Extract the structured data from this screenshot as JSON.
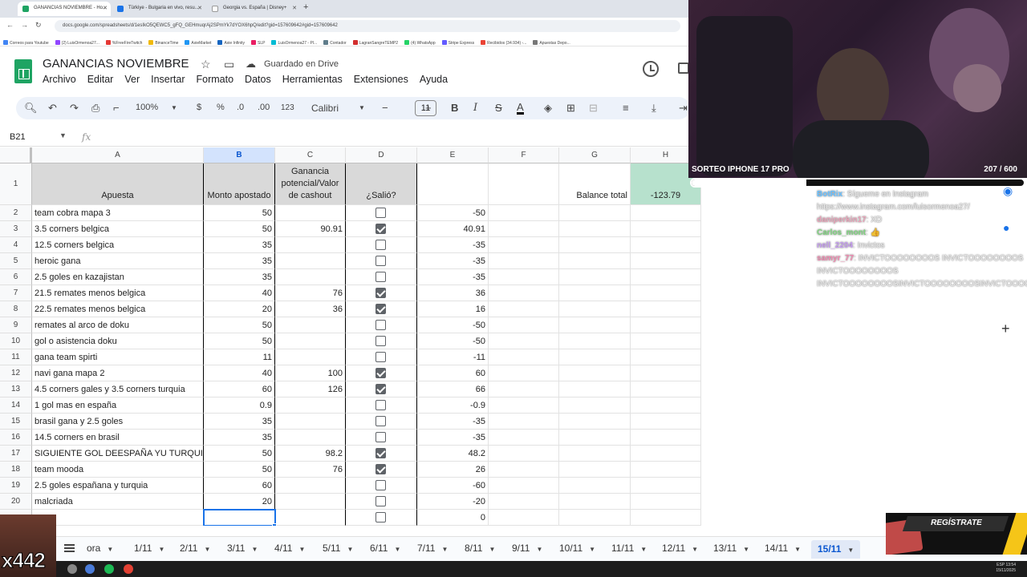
{
  "browser": {
    "tabs": [
      {
        "label": "GANANCIAS NOVIEMBRE - Ho...",
        "color": "#1fa463",
        "active": true
      },
      {
        "label": "Türkiye - Bulgaria en vivo, resu...",
        "color": "#1a73e8",
        "active": false
      },
      {
        "label": "Georgia vs. España | Disney+",
        "color": "#ffffff",
        "active": false
      }
    ],
    "url": "docs.google.com/spreadsheets/d/1esIkO5QEWC5_gFQ_GEHmuqrAj2SPmYk7dYOX6hpQ/edit?gid=157609642#gid=157609642",
    "bookmarks": [
      {
        "label": "Correos para Youtube",
        "color": "#4285f4"
      },
      {
        "label": "(2) LuisOrmenoa27...",
        "color": "#9146ff"
      },
      {
        "label": "%FreeFireTwitch",
        "color": "#e53935"
      },
      {
        "label": "BinanceTime",
        "color": "#f0b90b"
      },
      {
        "label": "AxieMarket",
        "color": "#2196f3"
      },
      {
        "label": "Axie Infinity",
        "color": "#1565c0"
      },
      {
        "label": "SLP",
        "color": "#e91e63"
      },
      {
        "label": "LuisOrmenoa27 - Pl...",
        "color": "#00bcd4"
      },
      {
        "label": "Contador",
        "color": "#607d8b"
      },
      {
        "label": "LagranSangreTEMP2",
        "color": "#d32f2f"
      },
      {
        "label": "(4) WhatsApp",
        "color": "#25d366"
      },
      {
        "label": "Stripe Express",
        "color": "#635bff"
      },
      {
        "label": "Recibidos (34.934) -...",
        "color": "#ea4335"
      },
      {
        "label": "Apuestas Depo...",
        "color": "#777777"
      }
    ]
  },
  "doc": {
    "title": "GANANCIAS NOVIEMBRE",
    "saved_status": "Guardado en Drive",
    "menu": [
      "Archivo",
      "Editar",
      "Ver",
      "Insertar",
      "Formato",
      "Datos",
      "Herramientas",
      "Extensiones",
      "Ayuda"
    ]
  },
  "toolbar": {
    "zoom": "100%",
    "currency": "$",
    "percent": "%",
    "dec_less": ".0",
    "dec_more": ".00",
    "number_format": "123",
    "font": "Calibri",
    "font_size": "11",
    "bold": "B",
    "italic": "I",
    "strike": "S",
    "text_color": "A"
  },
  "formula_bar": {
    "name_box": "B21",
    "fx": "fx"
  },
  "grid": {
    "columns": [
      "A",
      "B",
      "C",
      "D",
      "E",
      "F",
      "G",
      "H"
    ],
    "header": {
      "apuesta": "Apuesta",
      "monto": "Monto apostado",
      "ganancia_l1": "Ganancia",
      "ganancia_l2": "potencial/Valor",
      "ganancia_l3": "de cashout",
      "salio": "¿Salió?",
      "balance_label": "Balance total",
      "balance_value": "-123.79"
    },
    "rows": [
      {
        "n": "2",
        "a": "team cobra mapa 3",
        "b": "50",
        "c": "",
        "d": false,
        "e": "-50"
      },
      {
        "n": "3",
        "a": "3.5 corners belgica",
        "b": "50",
        "c": "90.91",
        "d": true,
        "e": "40.91"
      },
      {
        "n": "4",
        "a": "12.5 corners belgica",
        "b": "35",
        "c": "",
        "d": false,
        "e": "-35"
      },
      {
        "n": "5",
        "a": "heroic gana",
        "b": "35",
        "c": "",
        "d": false,
        "e": "-35"
      },
      {
        "n": "6",
        "a": "2.5 goles en kazajistan",
        "b": "35",
        "c": "",
        "d": false,
        "e": "-35"
      },
      {
        "n": "7",
        "a": "21.5 remates menos belgica",
        "b": "40",
        "c": "76",
        "d": true,
        "e": "36"
      },
      {
        "n": "8",
        "a": "22.5 remates menos belgica",
        "b": "20",
        "c": "36",
        "d": true,
        "e": "16"
      },
      {
        "n": "9",
        "a": "remates al arco de doku",
        "b": "50",
        "c": "",
        "d": false,
        "e": "-50"
      },
      {
        "n": "10",
        "a": "gol o asistencia doku",
        "b": "50",
        "c": "",
        "d": false,
        "e": "-50"
      },
      {
        "n": "11",
        "a": "gana team spirti",
        "b": "11",
        "c": "",
        "d": false,
        "e": "-11"
      },
      {
        "n": "12",
        "a": "navi gana mapa 2",
        "b": "40",
        "c": "100",
        "d": true,
        "e": "60"
      },
      {
        "n": "13",
        "a": "4.5 corners gales y 3.5 corners turquia",
        "b": "60",
        "c": "126",
        "d": true,
        "e": "66"
      },
      {
        "n": "14",
        "a": "1 gol mas en españa",
        "b": "0.9",
        "c": "",
        "d": false,
        "e": "-0.9"
      },
      {
        "n": "15",
        "a": "brasil gana y 2.5 goles",
        "b": "35",
        "c": "",
        "d": false,
        "e": "-35"
      },
      {
        "n": "16",
        "a": "14.5 corners en brasil",
        "b": "35",
        "c": "",
        "d": false,
        "e": "-35"
      },
      {
        "n": "17",
        "a": "SIGUIENTE GOL DEESPAÑA YU TURQUIA",
        "b": "50",
        "c": "98.2",
        "d": true,
        "e": "48.2"
      },
      {
        "n": "18",
        "a": "team mooda",
        "b": "50",
        "c": "76",
        "d": true,
        "e": "26"
      },
      {
        "n": "19",
        "a": "2.5 goles españana y turquia",
        "b": "60",
        "c": "",
        "d": false,
        "e": "-60"
      },
      {
        "n": "20",
        "a": "malcriada",
        "b": "20",
        "c": "",
        "d": false,
        "e": "-20"
      },
      {
        "n": "",
        "a": "",
        "b": "",
        "c": "",
        "d": false,
        "e": "0"
      }
    ]
  },
  "sheet_tabs": [
    "ora",
    "1/11",
    "2/11",
    "3/11",
    "4/11",
    "5/11",
    "6/11",
    "7/11",
    "8/11",
    "9/11",
    "10/11",
    "11/11",
    "12/11",
    "13/11",
    "14/11",
    "15/11"
  ],
  "active_sheet": "15/11",
  "overlay": {
    "raffle_title": "SORTEO IPHONE 17 PRO",
    "raffle_count": "207 / 600",
    "raffle_progress": 0.345,
    "chat": [
      {
        "user": "BotRix",
        "color": "#69c0ff",
        "msg": ": Sígueme en Instagram https://www.instagram.com/luisormenoa27/"
      },
      {
        "user": "daniperkin17",
        "color": "#e8a3b8",
        "msg": ": XD"
      },
      {
        "user": "Carlos_mont",
        "color": "#7fd37f",
        "msg": ": 👍"
      },
      {
        "user": "nell_2204",
        "color": "#c49bf0",
        "msg": ": Invictos"
      },
      {
        "user": "samyr_77",
        "color": "#f08ab0",
        "msg": ": INVICTOOOOOOOOS INVICTOOOOOOOOS INVICTOOOOOOOOS INVICTOOOOOOOOSINVICTOOOOOOOOSINVICTOOOOOOOOSINVICTOOOOOOOOS"
      }
    ],
    "promo_label": "REGÍSTRATE",
    "multiplier": "x442"
  },
  "system": {
    "time": "13:54",
    "date": "15/11/2025",
    "lang": "ESP"
  }
}
